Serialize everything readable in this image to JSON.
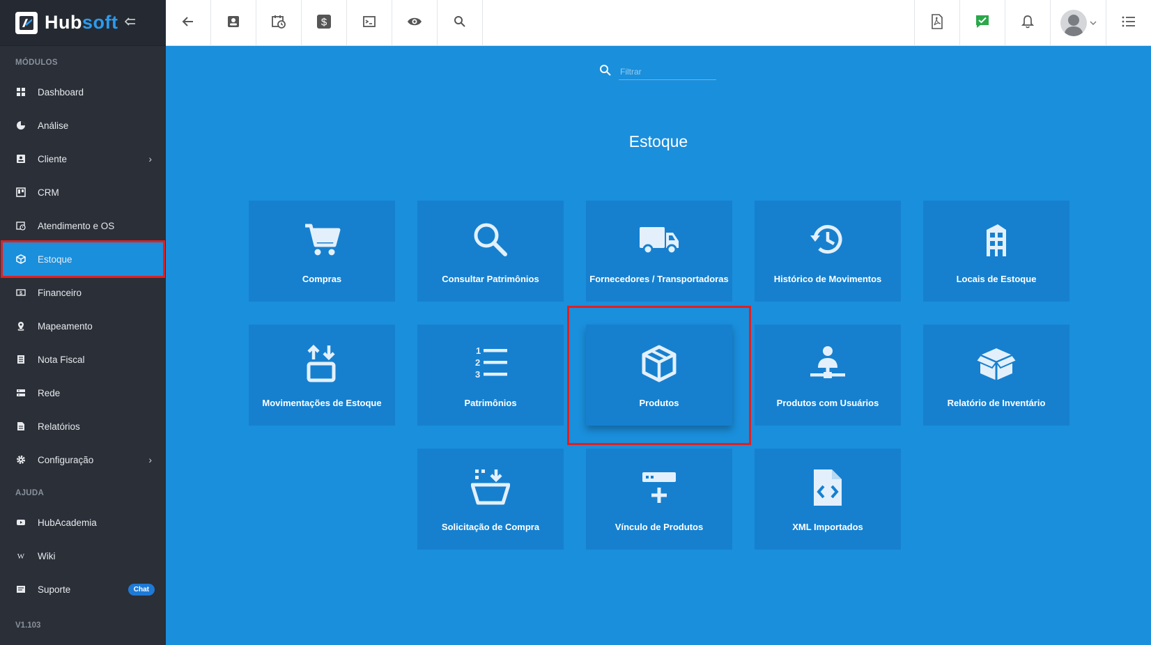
{
  "brand": {
    "hub": "Hub",
    "soft": "soft"
  },
  "sidebar": {
    "section_modules": "MÓDULOS",
    "section_help": "AJUDA",
    "version": "V1.103",
    "items": [
      {
        "label": "Dashboard",
        "icon": "dashboard-icon"
      },
      {
        "label": "Análise",
        "icon": "pie-chart-icon"
      },
      {
        "label": "Cliente",
        "icon": "contact-card-icon"
      },
      {
        "label": "CRM",
        "icon": "kanban-icon"
      },
      {
        "label": "Atendimento e OS",
        "icon": "calendar-clock-icon"
      },
      {
        "label": "Estoque",
        "icon": "box-icon"
      },
      {
        "label": "Financeiro",
        "icon": "money-icon"
      },
      {
        "label": "Mapeamento",
        "icon": "map-pin-icon"
      },
      {
        "label": "Nota Fiscal",
        "icon": "receipt-icon"
      },
      {
        "label": "Rede",
        "icon": "server-icon"
      },
      {
        "label": "Relatórios",
        "icon": "report-icon"
      },
      {
        "label": "Configuração",
        "icon": "gear-icon"
      }
    ],
    "help_items": [
      {
        "label": "HubAcademia",
        "icon": "youtube-icon"
      },
      {
        "label": "Wiki",
        "icon": "wikipedia-icon"
      },
      {
        "label": "Suporte",
        "icon": "message-icon",
        "badge": "Chat"
      }
    ],
    "active_item": "Estoque"
  },
  "filter": {
    "placeholder": "Filtrar"
  },
  "page": {
    "title": "Estoque"
  },
  "tiles": [
    {
      "label": "Compras",
      "icon": "cart-icon"
    },
    {
      "label": "Consultar Patrimônios",
      "icon": "magnifier-icon"
    },
    {
      "label": "Fornecedores / Transportadoras",
      "icon": "truck-icon"
    },
    {
      "label": "Histórico de Movimentos",
      "icon": "history-icon"
    },
    {
      "label": "Locais de Estoque",
      "icon": "building-icon"
    },
    {
      "label": "Movimentações de Estoque",
      "icon": "transfer-icon"
    },
    {
      "label": "Patrimônios",
      "icon": "numbered-list-icon"
    },
    {
      "label": "Produtos",
      "icon": "cube-icon"
    },
    {
      "label": "Produtos com Usuários",
      "icon": "user-network-icon"
    },
    {
      "label": "Relatório de Inventário",
      "icon": "open-box-icon"
    },
    {
      "label": "Solicitação de Compra",
      "icon": "basket-download-icon"
    },
    {
      "label": "Vínculo de Produtos",
      "icon": "link-add-icon"
    },
    {
      "label": "XML Importados",
      "icon": "code-file-icon"
    }
  ],
  "colors": {
    "sidebar": "#2a2f38",
    "main": "#1a8fdc",
    "tile": "#1680cf",
    "highlight": "#e02020",
    "chat_badge": "#1e7ad6"
  }
}
